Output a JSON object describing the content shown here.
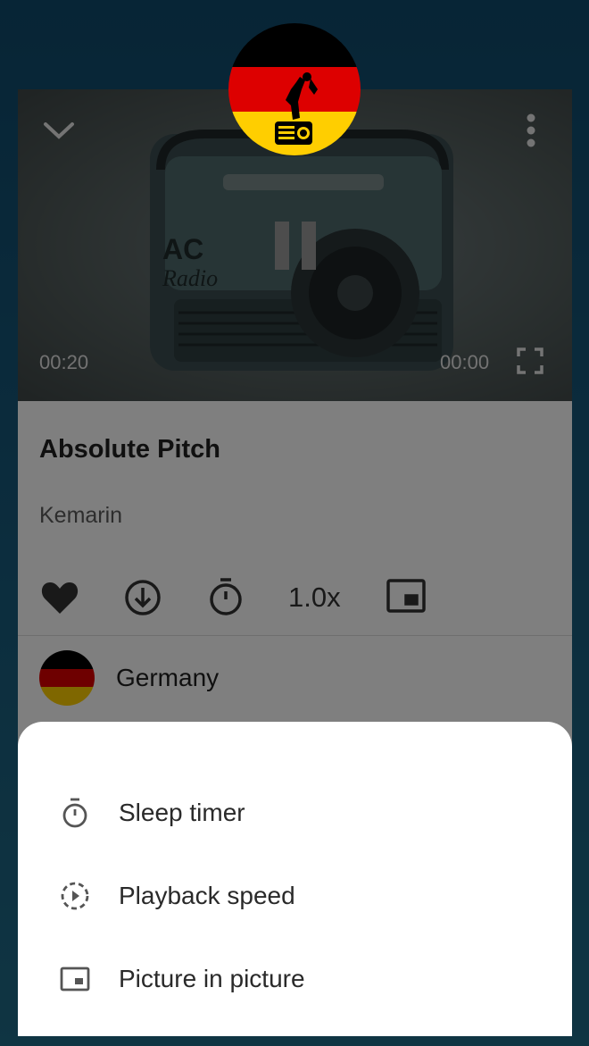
{
  "player": {
    "elapsed": "00:20",
    "remaining": "00:00",
    "artwork_text_top": "AC",
    "artwork_text_bottom": "Radio"
  },
  "track": {
    "title": "Absolute Pitch",
    "artist": "Kemarin"
  },
  "actions": {
    "speed_label": "1.0x"
  },
  "channel": {
    "name": "Germany"
  },
  "menu": {
    "items": [
      {
        "label": "Sleep timer",
        "icon": "timer-icon"
      },
      {
        "label": "Playback speed",
        "icon": "playback-speed-icon"
      },
      {
        "label": "Picture in picture",
        "icon": "picture-in-picture-icon"
      }
    ]
  },
  "colors": {
    "flag_black": "#000000",
    "flag_red": "#dd0000",
    "flag_gold": "#ffce00",
    "background": "#15547a"
  }
}
